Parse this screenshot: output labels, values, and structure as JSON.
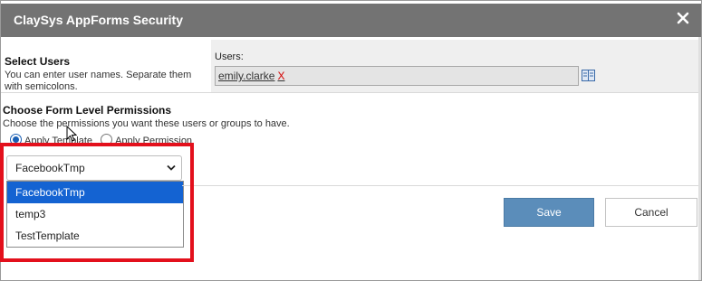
{
  "dialog": {
    "title": "ClaySys AppForms Security",
    "close_icon": "close-icon"
  },
  "select_users": {
    "heading": "Select Users",
    "description": "You can enter user names. Separate them with semicolons.",
    "users_label": "Users:",
    "users": [
      {
        "name": "emily.clarke",
        "remove": "X"
      }
    ],
    "book_icon": "address-book-icon"
  },
  "permissions": {
    "heading": "Choose Form Level Permissions",
    "description": "Choose the permissions you want these users or groups to have.",
    "radio_template": "Apply Template",
    "radio_permission": "Apply Permission",
    "selected_radio": "Apply Template"
  },
  "template_select": {
    "value": "FacebookTmp",
    "options": [
      "FacebookTmp",
      "temp3",
      "TestTemplate"
    ],
    "selected_index": 0
  },
  "buttons": {
    "save": "Save",
    "cancel": "Cancel"
  },
  "colors": {
    "titlebar": "#737373",
    "accent": "#1463d2",
    "save_button": "#5b8dba",
    "highlight": "#e3101c",
    "remove": "#d40000"
  }
}
